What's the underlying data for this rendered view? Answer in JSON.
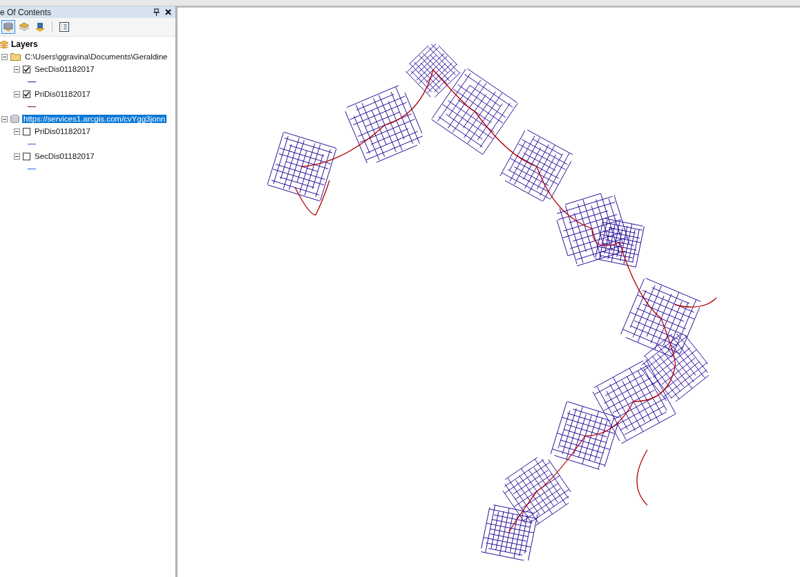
{
  "toc": {
    "title": "e Of Contents",
    "root": "Layers",
    "groups": [
      {
        "kind": "folder",
        "label": "C:\\Users\\ggravina\\Documents\\Geraldine",
        "selected": false,
        "expanded": true,
        "children": [
          {
            "label": "SecDis01182017",
            "checked": true,
            "expanded": true,
            "color": "#2a0f8a"
          },
          {
            "label": "PriDis01182017",
            "checked": true,
            "expanded": true,
            "color": "#8b0a0a"
          }
        ]
      },
      {
        "kind": "database",
        "label": "https://services1.arcgis.com/cvYgg3jonn",
        "selected": true,
        "expanded": true,
        "children": [
          {
            "label": "PriDis01182017",
            "checked": false,
            "expanded": true,
            "color": "#2060d0"
          },
          {
            "label": "SecDis01182017",
            "checked": false,
            "expanded": true,
            "color": "#2060d0"
          }
        ]
      }
    ]
  }
}
